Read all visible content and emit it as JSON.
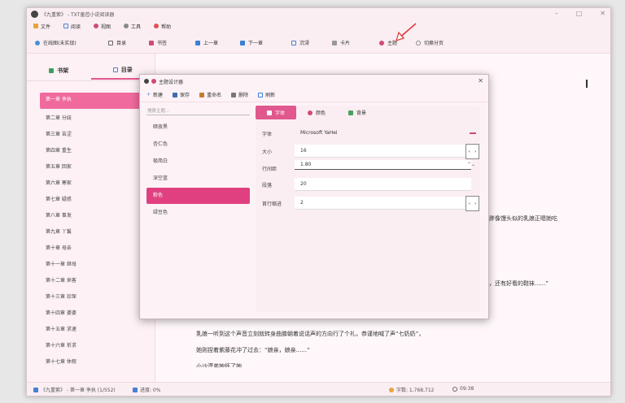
{
  "app": {
    "title": "《九重紫》 - TXT童芭小说阅读器"
  },
  "menu": [
    {
      "label": "文件",
      "icon": "folder-icon"
    },
    {
      "label": "阅读",
      "icon": "book-icon"
    },
    {
      "label": "视图",
      "icon": "eye-icon"
    },
    {
      "label": "工具",
      "icon": "gear-icon"
    },
    {
      "label": "帮助",
      "icon": "help-icon"
    }
  ],
  "toolbar": {
    "online": "在线图(未实现)",
    "toc": "目录",
    "bookmark": "书签",
    "prev": "上一章",
    "next": "下一章",
    "immersive": "沉浸",
    "card": "卡片",
    "theme": "主题",
    "split": "切换分页"
  },
  "sidebar": {
    "tab_shelf": "书架",
    "tab_toc": "目录",
    "chapters": [
      "第一章 争执",
      "第二章 分歧",
      "第三章 苦涩",
      "第四章 重生",
      "第五章 回家",
      "第六章 寒家",
      "第七章 疑惑",
      "第八章 事发",
      "第九章 丫鬟",
      "第十章 母亲",
      "第十一章 继母",
      "第十二章 来客",
      "第十三章 珍琛",
      "第十四章 婆婆",
      "第十五章 求速",
      "第十六章 祈求",
      "第十七章 休假"
    ]
  },
  "content": {
    "line1": "胖像馒头似的乳娘正嗯她吃",
    "line2": "，还有好看的鞋袜......”",
    "line3": "乳娘一听到这个声音立刻就转身曲膝朝着说话声的方向行了个礼，恭谨地喊了声“七奶奶”，",
    "line4": "她则捏着紫藤花冲了过去：“娘亲，娘亲......”",
    "line5": "小沙漠弟她怀了她"
  },
  "status": {
    "book": "《九重紫》 - 第一章 争执 (1/552)",
    "progress": "进度: 0%",
    "words": "字数: 1,768,712",
    "time": "09:38"
  },
  "dialog": {
    "title": "主题设计器",
    "tools": {
      "new": "新建",
      "save": "保存",
      "rename": "重命名",
      "delete": "删除",
      "refresh": "刷新"
    },
    "search_placeholder": "搜索主题...",
    "themes": [
      "暗夜黑",
      "杏仁色",
      "极简白",
      "深空蓝",
      "粉色",
      "绿豆色"
    ],
    "tabs": {
      "font": "字体",
      "color": "颜色",
      "background": "背景"
    },
    "fields": {
      "font_label": "字体",
      "font_value": "Microsoft YaHei",
      "size_label": "大小",
      "size_value": "16",
      "line_label": "行间距",
      "line_value": "1.80",
      "para_label": "段落",
      "para_value": "20",
      "indent_label": "首行缩进",
      "indent_value": "2"
    }
  },
  "colors": {
    "accent": "#e0588e",
    "background": "#fff5f8"
  }
}
